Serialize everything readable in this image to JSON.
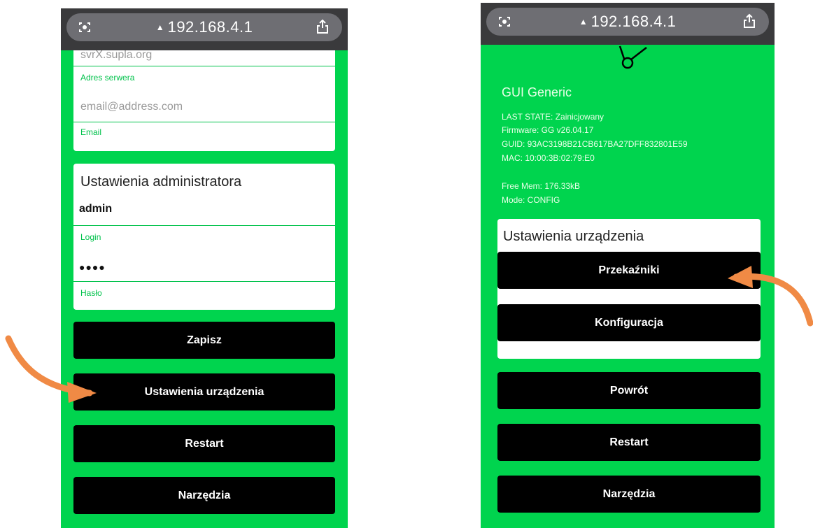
{
  "browser": {
    "url": "192.168.4.1"
  },
  "left": {
    "server_value": "svrX.supla.org",
    "server_label": "Adres serwera",
    "email_value": "email@address.com",
    "email_label": "Email",
    "admin_section_title": "Ustawienia administratora",
    "login_value": "admin",
    "login_label": "Login",
    "password_value": "●●●●",
    "password_label": "Hasło",
    "buttons": [
      "Zapisz",
      "Ustawienia urządzenia",
      "Restart",
      "Narzędzia"
    ]
  },
  "right": {
    "app_title": "GUI Generic",
    "info": {
      "last_state": "LAST STATE: Zainicjowany",
      "firmware": "Firmware: GG v26.04.17",
      "guid": "GUID: 93AC3198B21CB617BA27DFF832801E59",
      "mac": "MAC: 10:00:3B:02:79:E0",
      "free_mem": "Free Mem: 176.33kB",
      "mode": "Mode: CONFIG"
    },
    "device_section_title": "Ustawienia urządzenia",
    "section_buttons": [
      "Przekaźniki",
      "Konfiguracja"
    ],
    "buttons": [
      "Powrót",
      "Restart",
      "Narzędzia"
    ]
  },
  "colors": {
    "page_bg": "#00d44e",
    "accent": "#00c24b",
    "arrow": "#f08a45",
    "button": "#000000"
  }
}
